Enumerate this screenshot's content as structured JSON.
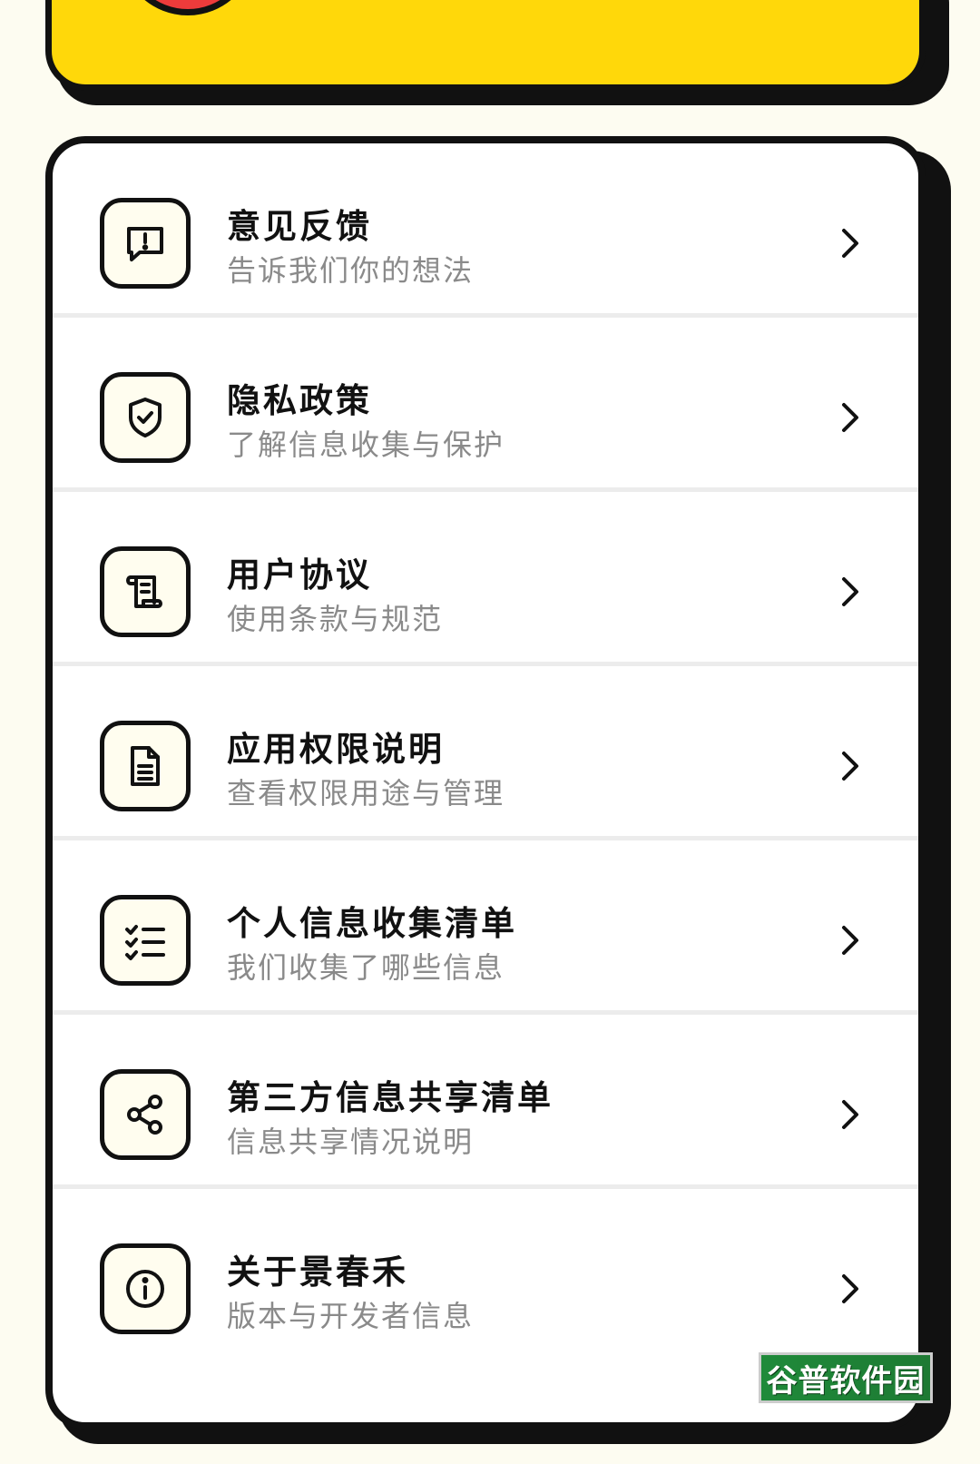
{
  "menu": {
    "items": [
      {
        "title": "意见反馈",
        "subtitle": "告诉我们你的想法",
        "icon": "feedback-icon"
      },
      {
        "title": "隐私政策",
        "subtitle": "了解信息收集与保护",
        "icon": "shield-check-icon"
      },
      {
        "title": "用户协议",
        "subtitle": "使用条款与规范",
        "icon": "scroll-icon"
      },
      {
        "title": "应用权限说明",
        "subtitle": "查看权限用途与管理",
        "icon": "document-icon"
      },
      {
        "title": "个人信息收集清单",
        "subtitle": "我们收集了哪些信息",
        "icon": "checklist-icon"
      },
      {
        "title": "第三方信息共享清单",
        "subtitle": "信息共享情况说明",
        "icon": "share-icon"
      },
      {
        "title": "关于景春禾",
        "subtitle": "版本与开发者信息",
        "icon": "info-icon"
      }
    ]
  },
  "watermark": {
    "text": "谷普软件园"
  },
  "colors": {
    "accent_yellow": "#FFD80A",
    "accent_red": "#EE3B3B",
    "accent_blue": "#1E90FF",
    "outline": "#111111",
    "background": "#FDFCF1"
  }
}
